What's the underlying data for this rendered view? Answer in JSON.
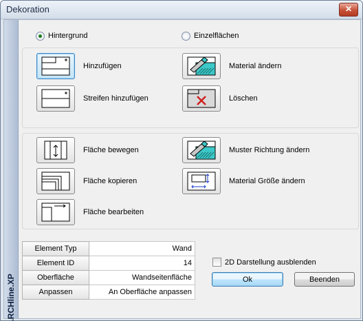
{
  "window": {
    "title": "Dekoration",
    "close_label": "✕"
  },
  "sidestrip": {
    "label": "ARCHline.XP"
  },
  "mode": {
    "options": [
      {
        "label": "Hintergrund",
        "checked": true
      },
      {
        "label": "Einzelflächen",
        "checked": false
      }
    ]
  },
  "group1": {
    "tools": [
      {
        "label": "Hinzufügen",
        "icon": "add-background-icon",
        "selected": true
      },
      {
        "label": "Material ändern",
        "icon": "change-material-icon",
        "selected": false
      },
      {
        "label": "Streifen hinzufügen",
        "icon": "add-stripe-icon",
        "selected": false
      },
      {
        "label": "Löschen",
        "icon": "delete-icon",
        "selected": false
      }
    ]
  },
  "group2": {
    "tools": [
      {
        "label": "Fläche bewegen",
        "icon": "move-surface-icon"
      },
      {
        "label": "Muster Richtung ändern",
        "icon": "pattern-direction-icon"
      },
      {
        "label": "Fläche kopieren",
        "icon": "copy-surface-icon"
      },
      {
        "label": "Material Größe ändern",
        "icon": "material-size-icon"
      },
      {
        "label": "Fläche bearbeiten",
        "icon": "edit-surface-icon"
      }
    ]
  },
  "properties": [
    {
      "key": "Element Typ",
      "value": "Wand"
    },
    {
      "key": "Element ID",
      "value": "14"
    },
    {
      "key": "Oberfläche",
      "value": "Wandseitenfläche"
    },
    {
      "key": "Anpassen",
      "value": "An Oberfläche anpassen"
    }
  ],
  "options": {
    "hide_2d_label": "2D Darstellung ausblenden",
    "hide_2d_checked": false
  },
  "buttons": {
    "ok": "Ok",
    "cancel": "Beenden"
  },
  "colors": {
    "accent": "#3a86c8",
    "material": "#3cc8c8",
    "delete": "#d02020"
  }
}
